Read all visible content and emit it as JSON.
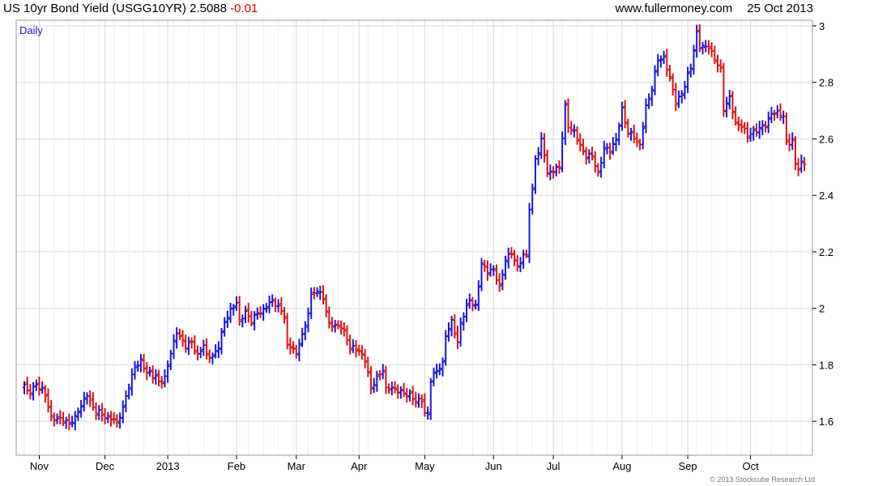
{
  "header": {
    "instrument": "US 10yr Bond Yield (USGG10YR)",
    "last": "2.5088",
    "change": "-0.01",
    "site": "www.fullermoney.com",
    "date": "25 Oct 2013"
  },
  "copyright": "© 2013 Stockcube Research Ltd",
  "colors": {
    "up": "#1515e0",
    "down": "#e01010",
    "grid": "#d8d8d8",
    "frame": "#9a9a9a"
  },
  "chart_data": {
    "type": "ohlc",
    "period_label": "Daily",
    "ylim": [
      1.48,
      3.02
    ],
    "yticks": [
      1.6,
      1.8,
      2,
      2.2,
      2.4,
      2.6,
      2.8,
      3
    ],
    "ytick_labels": [
      "1.6",
      "1.8",
      "2",
      "2.2",
      "2.4",
      "2.6",
      "2.8",
      "3"
    ],
    "xticks": [
      "Nov",
      "Dec",
      "2013",
      "Feb",
      "Mar",
      "Apr",
      "May",
      "Jun",
      "Jul",
      "Aug",
      "Sep",
      "Oct"
    ],
    "dates": [
      "2012-10-25",
      "2012-10-26",
      "2012-10-29",
      "2012-10-30",
      "2012-10-31",
      "2012-11-01",
      "2012-11-02",
      "2012-11-05",
      "2012-11-06",
      "2012-11-07",
      "2012-11-08",
      "2012-11-09",
      "2012-11-12",
      "2012-11-13",
      "2012-11-14",
      "2012-11-15",
      "2012-11-16",
      "2012-11-19",
      "2012-11-20",
      "2012-11-21",
      "2012-11-22",
      "2012-11-23",
      "2012-11-26",
      "2012-11-27",
      "2012-11-28",
      "2012-11-29",
      "2012-11-30",
      "2012-12-03",
      "2012-12-04",
      "2012-12-05",
      "2012-12-06",
      "2012-12-07",
      "2012-12-10",
      "2012-12-11",
      "2012-12-12",
      "2012-12-13",
      "2012-12-14",
      "2012-12-17",
      "2012-12-18",
      "2012-12-19",
      "2012-12-20",
      "2012-12-21",
      "2012-12-24",
      "2012-12-25",
      "2012-12-26",
      "2012-12-27",
      "2012-12-28",
      "2012-12-31",
      "2013-01-01",
      "2013-01-02",
      "2013-01-03",
      "2013-01-04",
      "2013-01-07",
      "2013-01-08",
      "2013-01-09",
      "2013-01-10",
      "2013-01-11",
      "2013-01-14",
      "2013-01-15",
      "2013-01-16",
      "2013-01-17",
      "2013-01-18",
      "2013-01-21",
      "2013-01-22",
      "2013-01-23",
      "2013-01-24",
      "2013-01-25",
      "2013-01-28",
      "2013-01-29",
      "2013-01-30",
      "2013-01-31",
      "2013-02-01",
      "2013-02-04",
      "2013-02-05",
      "2013-02-06",
      "2013-02-07",
      "2013-02-08",
      "2013-02-11",
      "2013-02-12",
      "2013-02-13",
      "2013-02-14",
      "2013-02-15",
      "2013-02-18",
      "2013-02-19",
      "2013-02-20",
      "2013-02-21",
      "2013-02-22",
      "2013-02-25",
      "2013-02-26",
      "2013-02-27",
      "2013-02-28",
      "2013-03-01",
      "2013-03-04",
      "2013-03-05",
      "2013-03-06",
      "2013-03-07",
      "2013-03-08",
      "2013-03-11",
      "2013-03-12",
      "2013-03-13",
      "2013-03-14",
      "2013-03-15",
      "2013-03-18",
      "2013-03-19",
      "2013-03-20",
      "2013-03-21",
      "2013-03-22",
      "2013-03-25",
      "2013-03-26",
      "2013-03-27",
      "2013-03-28",
      "2013-03-29",
      "2013-04-01",
      "2013-04-02",
      "2013-04-03",
      "2013-04-04",
      "2013-04-05",
      "2013-04-08",
      "2013-04-09",
      "2013-04-10",
      "2013-04-11",
      "2013-04-12",
      "2013-04-15",
      "2013-04-16",
      "2013-04-17",
      "2013-04-18",
      "2013-04-19",
      "2013-04-22",
      "2013-04-23",
      "2013-04-24",
      "2013-04-25",
      "2013-04-26",
      "2013-04-29",
      "2013-04-30",
      "2013-05-01",
      "2013-05-02",
      "2013-05-03",
      "2013-05-06",
      "2013-05-07",
      "2013-05-08",
      "2013-05-09",
      "2013-05-10",
      "2013-05-13",
      "2013-05-14",
      "2013-05-15",
      "2013-05-16",
      "2013-05-17",
      "2013-05-20",
      "2013-05-21",
      "2013-05-22",
      "2013-05-23",
      "2013-05-24",
      "2013-05-27",
      "2013-05-28",
      "2013-05-29",
      "2013-05-30",
      "2013-05-31",
      "2013-06-03",
      "2013-06-04",
      "2013-06-05",
      "2013-06-06",
      "2013-06-07",
      "2013-06-10",
      "2013-06-11",
      "2013-06-12",
      "2013-06-13",
      "2013-06-14",
      "2013-06-17",
      "2013-06-18",
      "2013-06-19",
      "2013-06-20",
      "2013-06-21",
      "2013-06-24",
      "2013-06-25",
      "2013-06-26",
      "2013-06-27",
      "2013-06-28",
      "2013-07-01",
      "2013-07-02",
      "2013-07-03",
      "2013-07-04",
      "2013-07-05",
      "2013-07-08",
      "2013-07-09",
      "2013-07-10",
      "2013-07-11",
      "2013-07-12",
      "2013-07-15",
      "2013-07-16",
      "2013-07-17",
      "2013-07-18",
      "2013-07-19",
      "2013-07-22",
      "2013-07-23",
      "2013-07-24",
      "2013-07-25",
      "2013-07-26",
      "2013-07-29",
      "2013-07-30",
      "2013-07-31",
      "2013-08-01",
      "2013-08-02",
      "2013-08-05",
      "2013-08-06",
      "2013-08-07",
      "2013-08-08",
      "2013-08-09",
      "2013-08-12",
      "2013-08-13",
      "2013-08-14",
      "2013-08-15",
      "2013-08-16",
      "2013-08-19",
      "2013-08-20",
      "2013-08-21",
      "2013-08-22",
      "2013-08-23",
      "2013-08-26",
      "2013-08-27",
      "2013-08-28",
      "2013-08-29",
      "2013-08-30",
      "2013-09-02",
      "2013-09-03",
      "2013-09-04",
      "2013-09-05",
      "2013-09-06",
      "2013-09-09",
      "2013-09-10",
      "2013-09-11",
      "2013-09-12",
      "2013-09-13",
      "2013-09-16",
      "2013-09-17",
      "2013-09-18",
      "2013-09-19",
      "2013-09-20",
      "2013-09-23",
      "2013-09-24",
      "2013-09-25",
      "2013-09-26",
      "2013-09-27",
      "2013-09-30",
      "2013-10-01",
      "2013-10-02",
      "2013-10-03",
      "2013-10-04",
      "2013-10-07",
      "2013-10-08",
      "2013-10-09",
      "2013-10-10",
      "2013-10-11",
      "2013-10-14",
      "2013-10-15",
      "2013-10-16",
      "2013-10-17",
      "2013-10-18",
      "2013-10-21",
      "2013-10-22",
      "2013-10-23",
      "2013-10-24",
      "2013-10-25"
    ],
    "close_anchors": [
      [
        "2012-10-25",
        1.73
      ],
      [
        "2012-10-26",
        1.71
      ],
      [
        "2012-10-29",
        1.7
      ],
      [
        "2012-10-31",
        1.73
      ],
      [
        "2012-11-02",
        1.72
      ],
      [
        "2012-11-05",
        1.69
      ],
      [
        "2012-11-07",
        1.62
      ],
      [
        "2012-11-09",
        1.61
      ],
      [
        "2012-11-13",
        1.6
      ],
      [
        "2012-11-15",
        1.59
      ],
      [
        "2012-11-19",
        1.62
      ],
      [
        "2012-11-23",
        1.69
      ],
      [
        "2012-11-27",
        1.65
      ],
      [
        "2012-11-30",
        1.62
      ],
      [
        "2012-12-04",
        1.62
      ],
      [
        "2012-12-07",
        1.6
      ],
      [
        "2012-12-11",
        1.65
      ],
      [
        "2012-12-13",
        1.72
      ],
      [
        "2012-12-17",
        1.79
      ],
      [
        "2012-12-19",
        1.82
      ],
      [
        "2012-12-21",
        1.77
      ],
      [
        "2012-12-24",
        1.78
      ],
      [
        "2012-12-27",
        1.74
      ],
      [
        "2012-12-31",
        1.76
      ],
      [
        "2013-01-02",
        1.84
      ],
      [
        "2013-01-04",
        1.91
      ],
      [
        "2013-01-07",
        1.9
      ],
      [
        "2013-01-09",
        1.86
      ],
      [
        "2013-01-11",
        1.88
      ],
      [
        "2013-01-15",
        1.84
      ],
      [
        "2013-01-17",
        1.87
      ],
      [
        "2013-01-18",
        1.84
      ],
      [
        "2013-01-22",
        1.83
      ],
      [
        "2013-01-24",
        1.86
      ],
      [
        "2013-01-28",
        1.95
      ],
      [
        "2013-01-30",
        2.0
      ],
      [
        "2013-02-01",
        2.02
      ],
      [
        "2013-02-04",
        1.96
      ],
      [
        "2013-02-06",
        1.99
      ],
      [
        "2013-02-08",
        1.95
      ],
      [
        "2013-02-12",
        1.98
      ],
      [
        "2013-02-14",
        2.0
      ],
      [
        "2013-02-19",
        2.03
      ],
      [
        "2013-02-21",
        2.01
      ],
      [
        "2013-02-25",
        1.97
      ],
      [
        "2013-02-26",
        1.87
      ],
      [
        "2013-02-28",
        1.86
      ],
      [
        "2013-03-01",
        1.84
      ],
      [
        "2013-03-04",
        1.87
      ],
      [
        "2013-03-06",
        1.94
      ],
      [
        "2013-03-08",
        2.05
      ],
      [
        "2013-03-12",
        2.06
      ],
      [
        "2013-03-14",
        2.03
      ],
      [
        "2013-03-15",
        1.99
      ],
      [
        "2013-03-18",
        1.95
      ],
      [
        "2013-03-20",
        1.94
      ],
      [
        "2013-03-22",
        1.93
      ],
      [
        "2013-03-25",
        1.92
      ],
      [
        "2013-03-27",
        1.86
      ],
      [
        "2013-03-29",
        1.85
      ],
      [
        "2013-04-01",
        1.85
      ],
      [
        "2013-04-03",
        1.81
      ],
      [
        "2013-04-05",
        1.72
      ],
      [
        "2013-04-09",
        1.76
      ],
      [
        "2013-04-11",
        1.78
      ],
      [
        "2013-04-12",
        1.72
      ],
      [
        "2013-04-16",
        1.72
      ],
      [
        "2013-04-18",
        1.7
      ],
      [
        "2013-04-22",
        1.7
      ],
      [
        "2013-04-24",
        1.7
      ],
      [
        "2013-04-26",
        1.67
      ],
      [
        "2013-04-30",
        1.67
      ],
      [
        "2013-05-01",
        1.63
      ],
      [
        "2013-05-02",
        1.63
      ],
      [
        "2013-05-03",
        1.74
      ],
      [
        "2013-05-07",
        1.78
      ],
      [
        "2013-05-09",
        1.81
      ],
      [
        "2013-05-10",
        1.9
      ],
      [
        "2013-05-14",
        1.96
      ],
      [
        "2013-05-16",
        1.88
      ],
      [
        "2013-05-17",
        1.95
      ],
      [
        "2013-05-20",
        1.97
      ],
      [
        "2013-05-22",
        2.03
      ],
      [
        "2013-05-24",
        2.01
      ],
      [
        "2013-05-28",
        2.16
      ],
      [
        "2013-05-30",
        2.12
      ],
      [
        "2013-06-03",
        2.14
      ],
      [
        "2013-06-05",
        2.08
      ],
      [
        "2013-06-07",
        2.17
      ],
      [
        "2013-06-11",
        2.19
      ],
      [
        "2013-06-13",
        2.15
      ],
      [
        "2013-06-17",
        2.19
      ],
      [
        "2013-06-18",
        2.19
      ],
      [
        "2013-06-19",
        2.35
      ],
      [
        "2013-06-20",
        2.42
      ],
      [
        "2013-06-21",
        2.53
      ],
      [
        "2013-06-24",
        2.55
      ],
      [
        "2013-06-25",
        2.6
      ],
      [
        "2013-06-26",
        2.54
      ],
      [
        "2013-06-27",
        2.48
      ],
      [
        "2013-07-01",
        2.48
      ],
      [
        "2013-07-03",
        2.5
      ],
      [
        "2013-07-05",
        2.72
      ],
      [
        "2013-07-08",
        2.64
      ],
      [
        "2013-07-10",
        2.63
      ],
      [
        "2013-07-12",
        2.58
      ],
      [
        "2013-07-16",
        2.53
      ],
      [
        "2013-07-18",
        2.54
      ],
      [
        "2013-07-22",
        2.48
      ],
      [
        "2013-07-24",
        2.57
      ],
      [
        "2013-07-26",
        2.55
      ],
      [
        "2013-07-30",
        2.6
      ],
      [
        "2013-08-01",
        2.71
      ],
      [
        "2013-08-05",
        2.62
      ],
      [
        "2013-08-07",
        2.6
      ],
      [
        "2013-08-09",
        2.58
      ],
      [
        "2013-08-13",
        2.72
      ],
      [
        "2013-08-15",
        2.77
      ],
      [
        "2013-08-19",
        2.88
      ],
      [
        "2013-08-21",
        2.89
      ],
      [
        "2013-08-23",
        2.82
      ],
      [
        "2013-08-27",
        2.72
      ],
      [
        "2013-08-29",
        2.76
      ],
      [
        "2013-09-03",
        2.85
      ],
      [
        "2013-09-05",
        2.98
      ],
      [
        "2013-09-06",
        2.92
      ],
      [
        "2013-09-09",
        2.93
      ],
      [
        "2013-09-11",
        2.92
      ],
      [
        "2013-09-13",
        2.88
      ],
      [
        "2013-09-17",
        2.85
      ],
      [
        "2013-09-18",
        2.7
      ],
      [
        "2013-09-20",
        2.75
      ],
      [
        "2013-09-24",
        2.66
      ],
      [
        "2013-09-26",
        2.64
      ],
      [
        "2013-09-30",
        2.61
      ],
      [
        "2013-10-02",
        2.63
      ],
      [
        "2013-10-04",
        2.64
      ],
      [
        "2013-10-08",
        2.64
      ],
      [
        "2013-10-10",
        2.69
      ],
      [
        "2013-10-14",
        2.7
      ],
      [
        "2013-10-16",
        2.68
      ],
      [
        "2013-10-17",
        2.59
      ],
      [
        "2013-10-18",
        2.58
      ],
      [
        "2013-10-21",
        2.6
      ],
      [
        "2013-10-22",
        2.51
      ],
      [
        "2013-10-23",
        2.49
      ],
      [
        "2013-10-24",
        2.52
      ],
      [
        "2013-10-25",
        2.51
      ]
    ]
  }
}
